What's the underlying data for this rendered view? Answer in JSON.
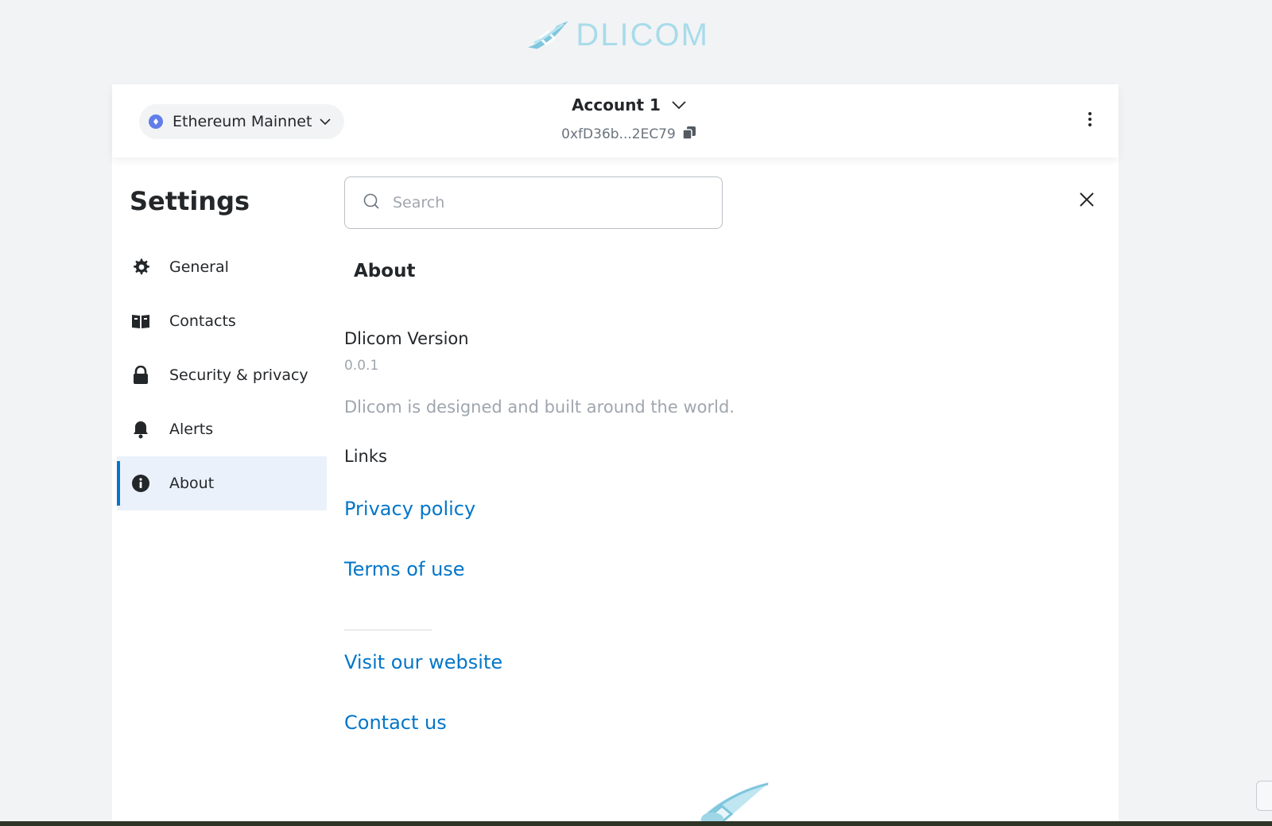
{
  "brand": {
    "wordmark": "DLICOM"
  },
  "header": {
    "network_label": "Ethereum Mainnet",
    "account_name": "Account 1",
    "address": "0xfD36b...2EC79"
  },
  "settings": {
    "title": "Settings",
    "search_placeholder": "Search",
    "nav": [
      {
        "label": "General",
        "icon": "gear-icon"
      },
      {
        "label": "Contacts",
        "icon": "book-icon"
      },
      {
        "label": "Security & privacy",
        "icon": "lock-icon"
      },
      {
        "label": "Alerts",
        "icon": "bell-icon"
      },
      {
        "label": "About",
        "icon": "info-icon",
        "active": true
      }
    ]
  },
  "about": {
    "heading": "About",
    "version_label": "Dlicom Version",
    "version_value": "0.0.1",
    "tagline": "Dlicom is designed and built around the world.",
    "links_heading": "Links",
    "links": {
      "privacy": "Privacy policy",
      "terms": "Terms of use",
      "website": "Visit our website",
      "contact": "Contact us"
    }
  },
  "colors": {
    "accent": "#0376c9",
    "active_bg": "#eaf1fa",
    "brand": "#a8dcea",
    "network_dot": "#627eea"
  }
}
